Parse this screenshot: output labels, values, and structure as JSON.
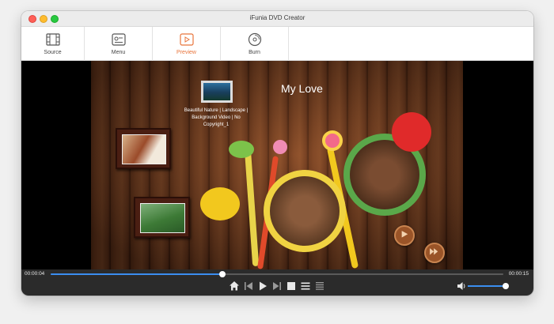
{
  "window": {
    "title": "iFunia DVD Creator"
  },
  "toolbar": {
    "tabs": [
      {
        "label": "Source",
        "icon": "film-icon",
        "active": false
      },
      {
        "label": "Menu",
        "icon": "menu-icon",
        "active": false
      },
      {
        "label": "Preview",
        "icon": "preview-icon",
        "active": true
      },
      {
        "label": "Burn",
        "icon": "disc-icon",
        "active": false
      }
    ],
    "accent": "#e8743b"
  },
  "preview": {
    "menu_title": "My Love",
    "chapter_label": "Beautiful Nature | Landscape | Background Video | No Copyright_1"
  },
  "player": {
    "current_time": "00:00:04",
    "duration": "00:00:15",
    "progress_fraction": 0.38,
    "volume_fraction": 1.0,
    "accent": "#3b8ef0"
  }
}
